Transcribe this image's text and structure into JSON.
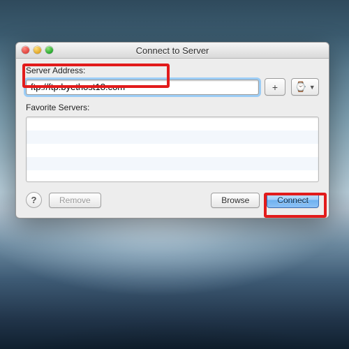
{
  "window": {
    "title": "Connect to Server",
    "server_address_label": "Server Address:",
    "server_address_value": "ftp://ftp.byethost18.com",
    "favorite_servers_label": "Favorite Servers:",
    "favorites": [],
    "add_button_label": "+",
    "history_menu_glyph": "⌚",
    "help_label": "?",
    "remove_label": "Remove",
    "browse_label": "Browse",
    "connect_label": "Connect"
  }
}
